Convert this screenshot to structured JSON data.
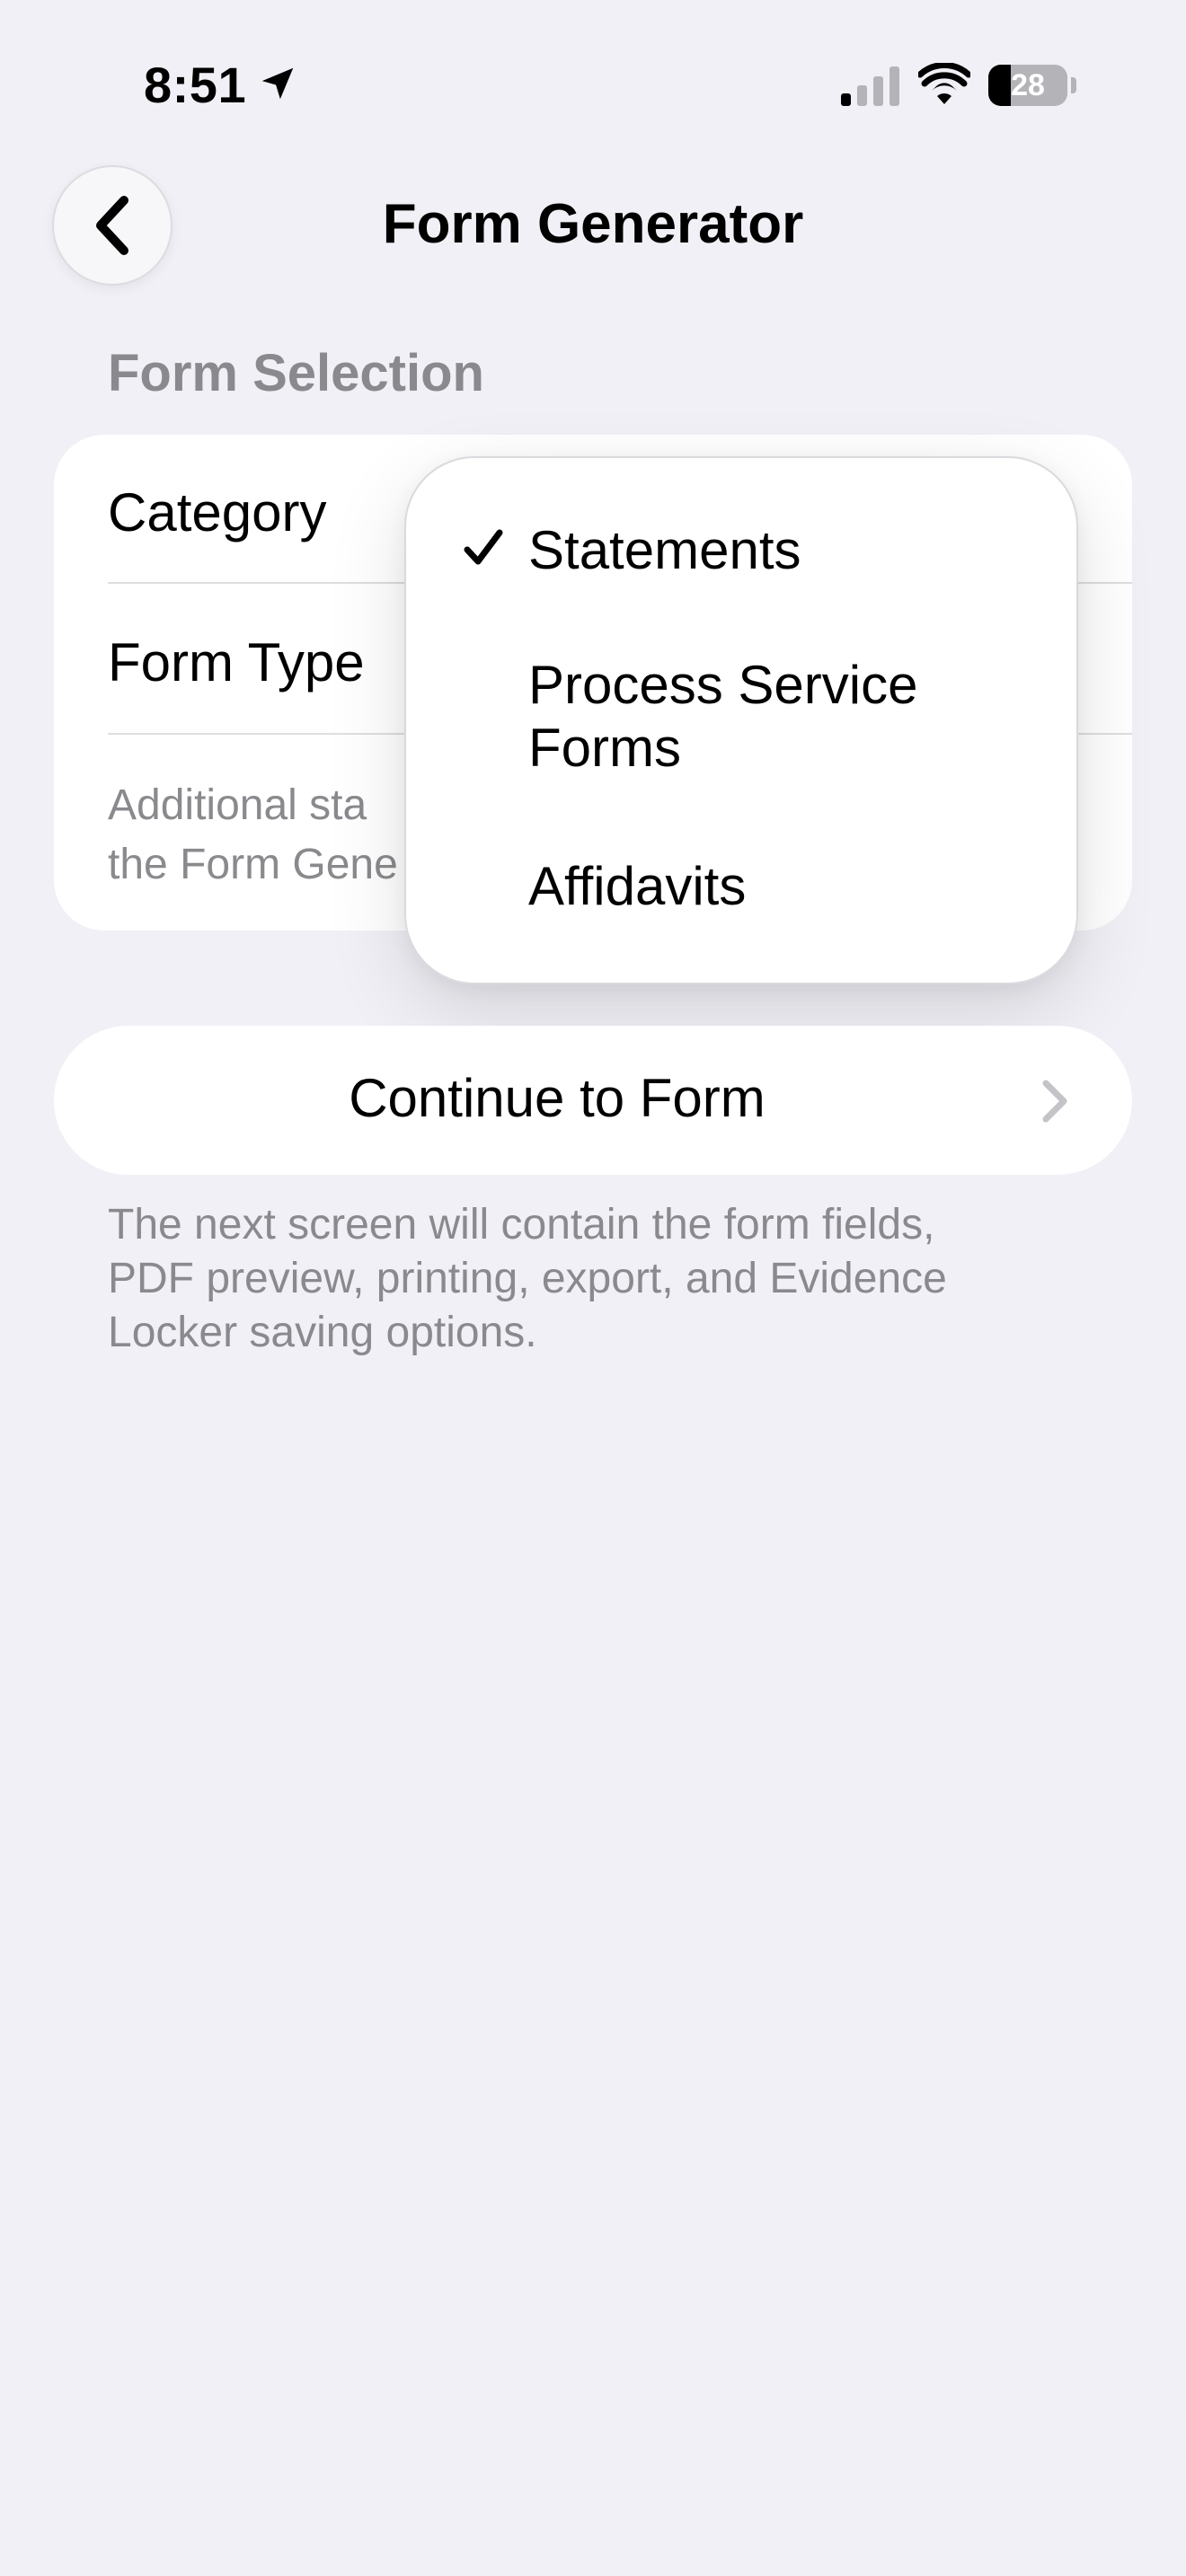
{
  "status_bar": {
    "time": "8:51",
    "battery": "28",
    "icons": [
      "location-arrow-icon",
      "cellular-signal-icon",
      "wifi-icon",
      "battery-icon"
    ]
  },
  "header": {
    "back_icon": "chevron-left-icon",
    "title": "Form Generator"
  },
  "form_selection": {
    "section_title": "Form Selection",
    "category_label": "Category",
    "form_type_label": "Form Type",
    "footnote_line1": "Additional sta",
    "footnote_line2": "the Form Gene"
  },
  "dropdown": {
    "selected_index": 0,
    "items": [
      {
        "label": "Statements",
        "checked": true
      },
      {
        "label_line1": "Process Service",
        "label_line2": "Forms",
        "checked": false
      },
      {
        "label": "Affidavits",
        "checked": false
      }
    ]
  },
  "continue": {
    "label": "Continue to Form",
    "icon": "chevron-right-icon"
  },
  "help": {
    "line1": "The next screen will contain the form fields,",
    "line2": "PDF preview, printing, export, and Evidence",
    "line3": "Locker saving options."
  },
  "colors": {
    "background": "#f1f0f6",
    "card": "#ffffff",
    "secondary_text": "#8a8a8e"
  }
}
